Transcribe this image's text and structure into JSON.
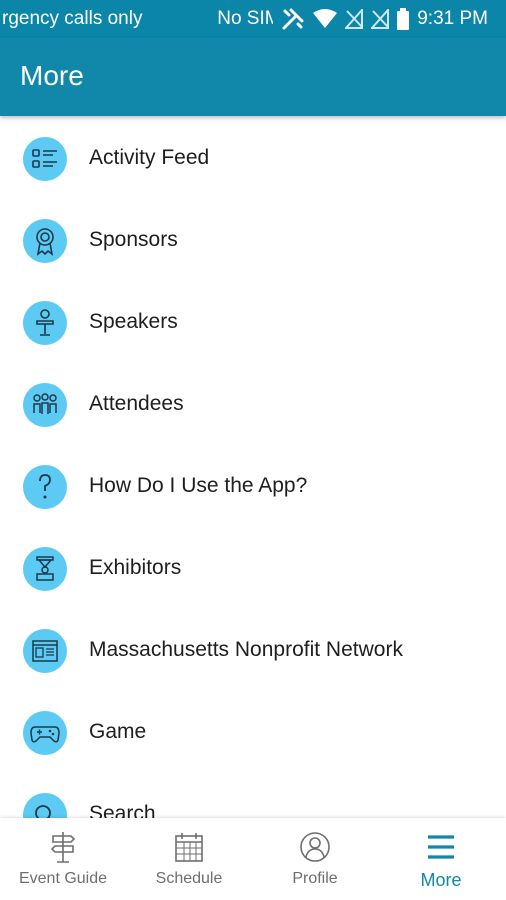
{
  "status_bar": {
    "carrier_text": "rgency calls only",
    "sim_text": "No SIM",
    "time": "9:31 PM",
    "icons": [
      "no-sim-icon",
      "tools-icon",
      "wifi-icon",
      "no-signal-icon",
      "no-signal-icon",
      "battery-icon"
    ]
  },
  "header": {
    "title": "More"
  },
  "menu": {
    "items": [
      {
        "label": "Activity Feed",
        "icon": "activity-feed-icon"
      },
      {
        "label": "Sponsors",
        "icon": "ribbon-award-icon"
      },
      {
        "label": "Speakers",
        "icon": "podium-speaker-icon"
      },
      {
        "label": "Attendees",
        "icon": "people-group-icon"
      },
      {
        "label": "How Do I Use the App?",
        "icon": "question-mark-icon"
      },
      {
        "label": "Exhibitors",
        "icon": "exhibitor-booth-icon"
      },
      {
        "label": "Massachusetts Nonprofit Network",
        "icon": "browser-window-icon"
      },
      {
        "label": "Game",
        "icon": "gamepad-icon"
      },
      {
        "label": "Search",
        "icon": "search-icon"
      }
    ]
  },
  "bottom_nav": {
    "items": [
      {
        "label": "Event Guide",
        "icon": "signpost-icon"
      },
      {
        "label": "Schedule",
        "icon": "calendar-icon"
      },
      {
        "label": "Profile",
        "icon": "profile-icon"
      },
      {
        "label": "More",
        "icon": "hamburger-menu-icon"
      }
    ],
    "active": "More"
  },
  "colors": {
    "primary": "#1187aa",
    "status_bar": "#0b86a8",
    "icon_circle": "#5ccaf3",
    "text": "#1e1e1e",
    "nav_inactive": "#6e6e6e"
  }
}
